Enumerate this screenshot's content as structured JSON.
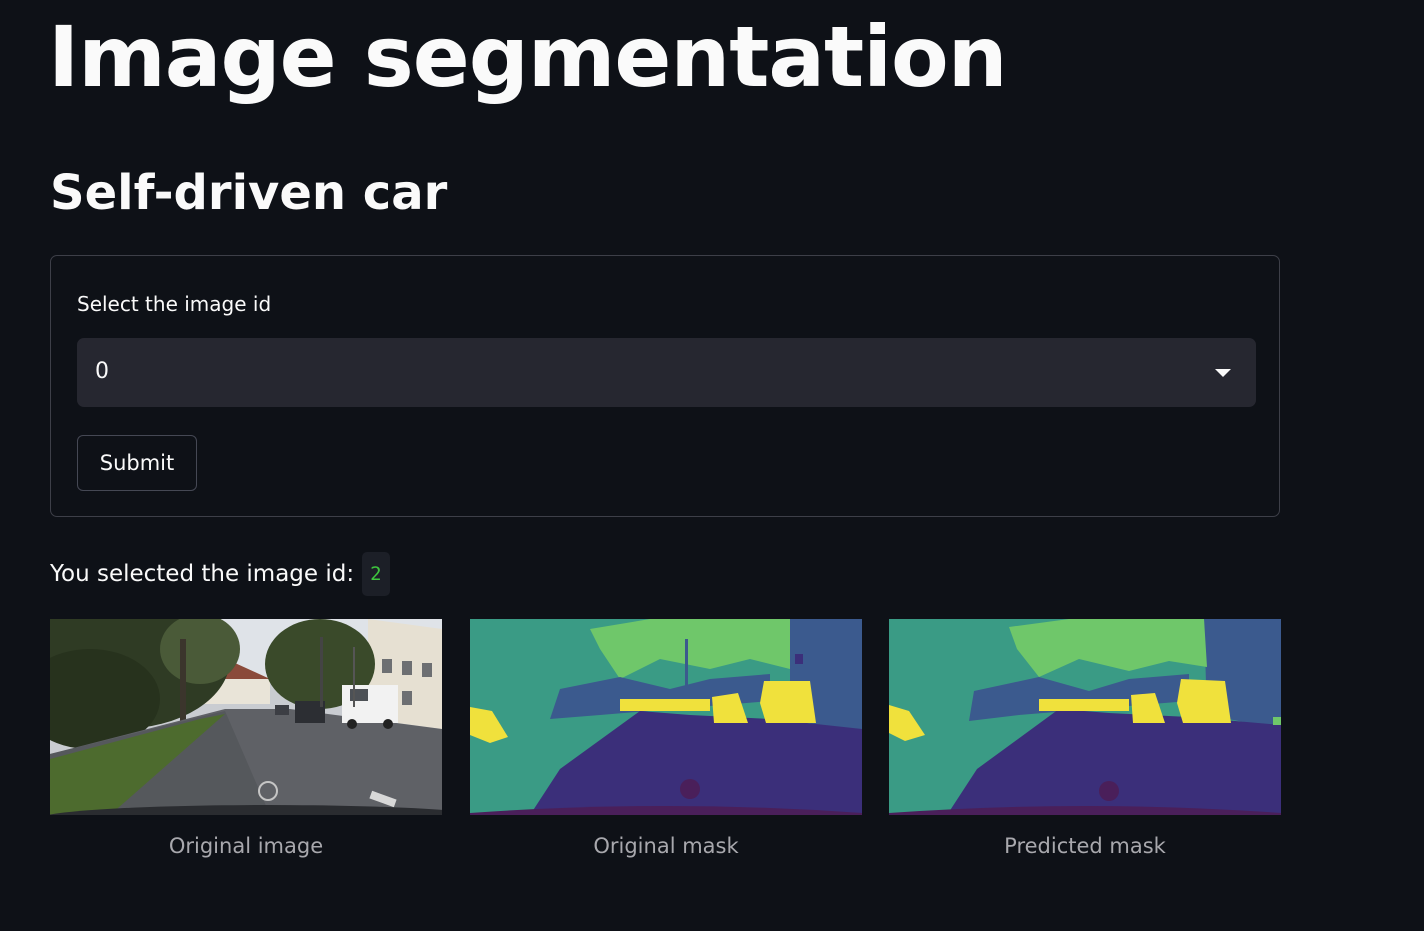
{
  "title": "Image segmentation",
  "subtitle": "Self-driven car",
  "form": {
    "label": "Select the image id",
    "selected_value": "0",
    "submit_label": "Submit"
  },
  "result": {
    "prefix": "You selected the image id:",
    "value": "2"
  },
  "figures": [
    {
      "caption": "Original image"
    },
    {
      "caption": "Original mask"
    },
    {
      "caption": "Predicted mask"
    }
  ],
  "colors": {
    "background": "#0e1117",
    "select_bg": "#262730",
    "code_text": "#3ec53e",
    "mask_road": "#3b2f7a",
    "mask_ground": "#3a9b85",
    "mask_vegetation": "#6fc76a",
    "mask_building": "#3b5a8e",
    "mask_vehicle": "#f0e13c",
    "mask_hood": "#4a1f5a"
  }
}
